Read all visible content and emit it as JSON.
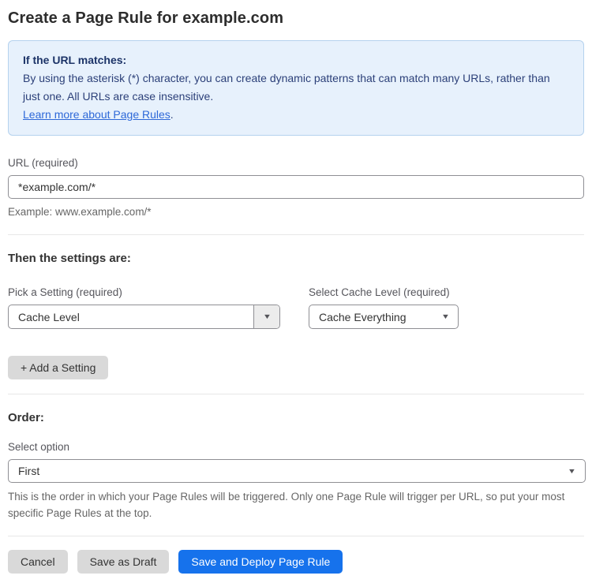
{
  "page": {
    "title": "Create a Page Rule for example.com"
  },
  "info_box": {
    "heading": "If the URL matches:",
    "body": "By using the asterisk (*) character, you can create dynamic patterns that can match many URLs, rather than just one. All URLs are case insensitive.",
    "link_label": "Learn more about Page Rules",
    "link_suffix": "."
  },
  "url_field": {
    "label": "URL (required)",
    "value": "*example.com/*",
    "helper": "Example: www.example.com/*"
  },
  "settings_section": {
    "heading": "Then the settings are:",
    "setting_picker": {
      "label": "Pick a Setting (required)",
      "value": "Cache Level"
    },
    "cache_level_picker": {
      "label": "Select Cache Level (required)",
      "value": "Cache Everything"
    },
    "add_setting_label": "+ Add a Setting"
  },
  "order_section": {
    "heading": "Order:",
    "select_label": "Select option",
    "value": "First",
    "helper": "This is the order in which your Page Rules will be triggered. Only one Page Rule will trigger per URL, so put your most specific Page Rules at the top."
  },
  "actions": {
    "cancel_label": "Cancel",
    "save_draft_label": "Save as Draft",
    "save_deploy_label": "Save and Deploy Page Rule"
  },
  "icons": {
    "dropdown_arrow": "▼"
  },
  "colors": {
    "accent_blue": "#1672ec",
    "info_bg": "#e7f1fc",
    "info_border": "#b5d2ee",
    "info_text": "#2c4079",
    "link_blue": "#2d68d8",
    "button_gray": "#d9d9d9"
  }
}
